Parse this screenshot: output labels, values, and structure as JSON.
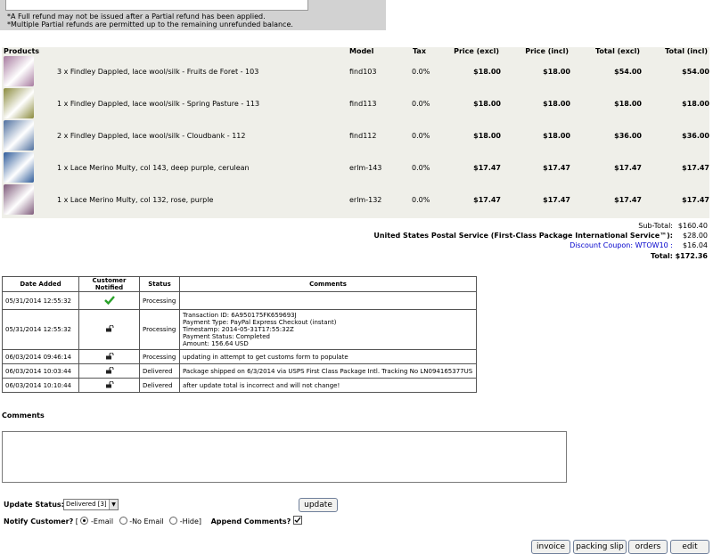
{
  "refund": {
    "note1": "*A Full refund may not be issued after a Partial refund has been applied.",
    "note2": "*Multiple Partial refunds are permitted up to the remaining unrefunded balance."
  },
  "products": {
    "headers": {
      "products": "Products",
      "model": "Model",
      "tax": "Tax",
      "price_excl": "Price (excl)",
      "price_incl": "Price (incl)",
      "total_excl": "Total (excl)",
      "total_incl": "Total (incl)"
    },
    "rows": [
      {
        "name": "3 x Findley Dappled, lace wool/silk - Fruits de Foret - 103",
        "model": "find103",
        "tax": "0.0%",
        "price_excl": "$18.00",
        "price_incl": "$18.00",
        "total_excl": "$54.00",
        "total_incl": "$54.00",
        "color": "#a77b9f"
      },
      {
        "name": "1 x Findley Dappled, lace wool/silk - Spring Pasture - 113",
        "model": "find113",
        "tax": "0.0%",
        "price_excl": "$18.00",
        "price_incl": "$18.00",
        "total_excl": "$18.00",
        "total_incl": "$18.00",
        "color": "#8a8a3c"
      },
      {
        "name": "2 x Findley Dappled, lace wool/silk - Cloudbank - 112",
        "model": "find112",
        "tax": "0.0%",
        "price_excl": "$18.00",
        "price_incl": "$18.00",
        "total_excl": "$36.00",
        "total_incl": "$36.00",
        "color": "#4e6f9e"
      },
      {
        "name": "1 x Lace Merino Multy, col 143, deep purple, cerulean",
        "model": "erlm-143",
        "tax": "0.0%",
        "price_excl": "$17.47",
        "price_incl": "$17.47",
        "total_excl": "$17.47",
        "total_incl": "$17.47",
        "color": "#2f5c9a"
      },
      {
        "name": "1 x Lace Merino Multy, col 132, rose, purple",
        "model": "erlm-132",
        "tax": "0.0%",
        "price_excl": "$17.47",
        "price_incl": "$17.47",
        "total_excl": "$17.47",
        "total_incl": "$17.47",
        "color": "#7e5a7a"
      }
    ]
  },
  "totals": {
    "subtotal_label": "Sub-Total:",
    "subtotal_value": "$160.40",
    "shipping_label": "United States Postal Service (First-Class Package International Service™):",
    "shipping_value": "$28.00",
    "coupon_label": "Discount Coupon: WTOW10 :",
    "coupon_value": "$16.04",
    "total_label": "Total:",
    "total_value": "$172.36"
  },
  "history": {
    "headers": {
      "date": "Date Added",
      "notified": "Customer Notified",
      "status": "Status",
      "comments": "Comments"
    },
    "rows": [
      {
        "date": "05/31/2014 12:55:32",
        "notified": "check-icon",
        "status": "Processing",
        "comments": [
          ""
        ]
      },
      {
        "date": "05/31/2014 12:55:32",
        "notified": "lock-icon",
        "status": "Processing",
        "comments": [
          "Transaction ID: 6A950175FK659693J",
          "Payment Type: PayPal Express Checkout (instant)",
          "Timestamp: 2014-05-31T17:55:32Z",
          "Payment Status: Completed",
          "Amount: 156.64 USD"
        ]
      },
      {
        "date": "06/03/2014 09:46:14",
        "notified": "lock-icon",
        "status": "Processing",
        "comments": [
          "updating in attempt to get customs form to populate"
        ]
      },
      {
        "date": "06/03/2014 10:03:44",
        "notified": "lock-icon",
        "status": "Delivered",
        "comments": [
          "Package shipped on 6/3/2014 via USPS First Class Package Intl. Tracking No LN094165377US"
        ]
      },
      {
        "date": "06/03/2014 10:10:44",
        "notified": "lock-icon",
        "status": "Delivered",
        "comments": [
          "after update total is incorrect and will not change!"
        ]
      }
    ]
  },
  "comments": {
    "label": "Comments"
  },
  "update": {
    "status_label": "Update Status:",
    "status_value": "Delivered [3]",
    "update_button": "update",
    "notify_label": "Notify Customer?",
    "bracket_open": "[",
    "email_label": "-Email",
    "no_email_label": "-No Email",
    "hide_label": "-Hide]",
    "append_label": "Append Comments?"
  },
  "buttons": {
    "invoice": "invoice",
    "packing_slip": "packing slip",
    "orders": "orders",
    "edit": "edit"
  },
  "colors": {
    "link": "#0000cc",
    "check": "#2aa12a",
    "table_bg": "#efefe9",
    "panel_bg": "#d2d2d2"
  }
}
